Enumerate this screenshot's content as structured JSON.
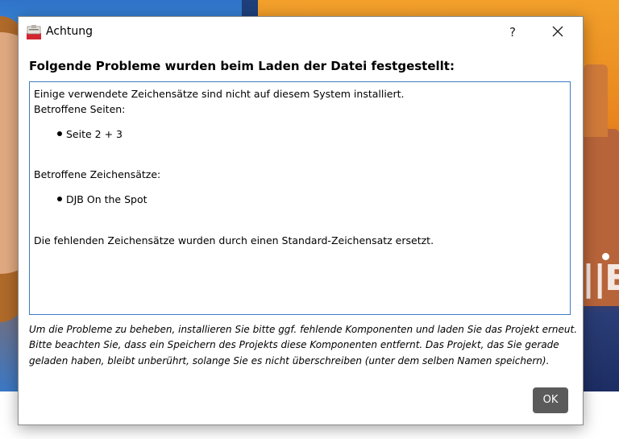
{
  "window": {
    "title": "Achtung",
    "help_symbol": "?",
    "close_symbol": "✕",
    "icon": "app-photo-book-icon"
  },
  "dialog": {
    "heading": "Folgende Probleme wurden beim Laden der Datei festgestellt:",
    "report": {
      "intro": "Einige verwendete Zeichensätze sind nicht auf diesem System installiert.",
      "pages_label": "Betroffene Seiten:",
      "pages": [
        "Seite 2 + 3"
      ],
      "fonts_label": "Betroffene Zeichensätze:",
      "fonts": [
        "DJB On the Spot"
      ],
      "resolution": "Die fehlenden Zeichensätze wurden durch einen Standard-Zeichensatz ersetzt."
    },
    "footnote": "Um die Probleme zu beheben, installieren Sie bitte ggf. fehlende Komponenten und laden Sie das Projekt erneut. Bitte beachten Sie, dass ein Speichern des Projekts diese Komponenten entfernt. Das Projekt, das Sie gerade geladen haben, bleibt unberührt, solange Sie es nicht überschreiben (unter dem selben Namen speichern).",
    "ok_label": "OK"
  },
  "colors": {
    "content_border": "#3c7cc6",
    "ok_button_bg": "#5b5b5b",
    "ok_button_text": "#ffffff"
  }
}
